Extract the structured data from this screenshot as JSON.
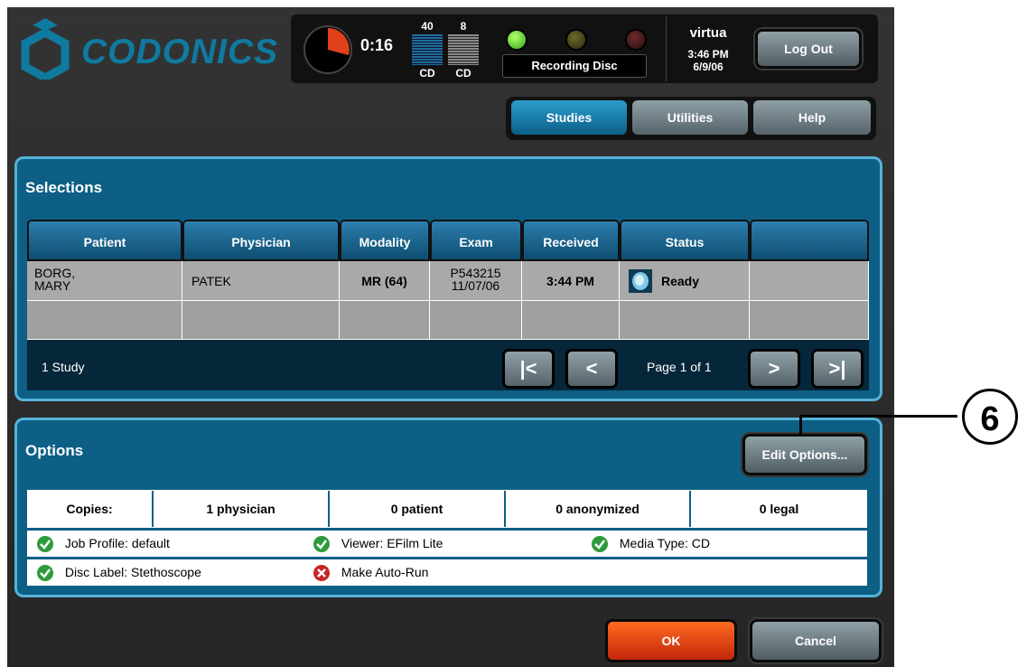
{
  "header": {
    "brand": "CODONICS",
    "timer": "0:16",
    "stack1_count": "40",
    "stack1_label": "CD",
    "stack2_count": "8",
    "stack2_label": "CD",
    "recording_status": "Recording Disc",
    "user": "virtua",
    "time": "3:46 PM",
    "date": "6/9/06",
    "logout_label": "Log Out"
  },
  "tabs": [
    {
      "label": "Studies",
      "active": true
    },
    {
      "label": "Utilities",
      "active": false
    },
    {
      "label": "Help",
      "active": false
    }
  ],
  "selections": {
    "title": "Selections",
    "columns": [
      "Patient",
      "Physician",
      "Modality",
      "Exam",
      "Received",
      "Status",
      ""
    ],
    "rows": [
      {
        "patient": "BORG,\nMARY",
        "physician": "PATEK",
        "modality": "MR (64)",
        "exam": "P543215\n11/07/06",
        "received": "3:44 PM",
        "status": "Ready"
      }
    ],
    "count_text": "1  Study",
    "page_text": "Page 1 of 1",
    "nav": {
      "first": "|<",
      "prev": "<",
      "next": ">",
      "last": ">|"
    }
  },
  "options": {
    "title": "Options",
    "edit_label": "Edit Options...",
    "copies_label": "Copies:",
    "copies": [
      "1   physician",
      "0   patient",
      "0   anonymized",
      "0   legal"
    ],
    "items_row1": [
      {
        "label": "Job Profile: default",
        "state": "ok"
      },
      {
        "label": "Viewer: EFilm Lite",
        "state": "ok"
      },
      {
        "label": "Media Type: CD",
        "state": "ok"
      }
    ],
    "items_row2": [
      {
        "label": "Disc Label: Stethoscope",
        "state": "ok"
      },
      {
        "label": "Make Auto-Run",
        "state": "error"
      }
    ]
  },
  "callout": "6",
  "footer": {
    "ok": "OK",
    "cancel": "Cancel"
  },
  "colors": {
    "accent": "#0d5f86",
    "ok": "#e04516",
    "check": "#2e9b3a",
    "error": "#c62828"
  }
}
